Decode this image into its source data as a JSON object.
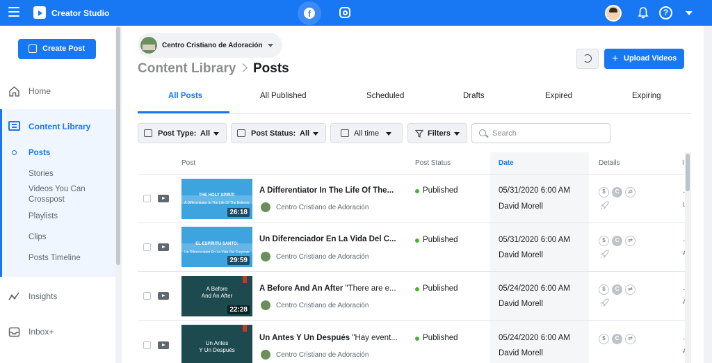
{
  "app": {
    "title": "Creator Studio",
    "brand_color": "#1877f2",
    "platform_tabs": [
      {
        "name": "facebook",
        "glyph": "f",
        "active": true
      },
      {
        "name": "instagram",
        "active": false
      }
    ],
    "help_glyph": "?"
  },
  "sidebar": {
    "create_post": "Create Post",
    "home": "Home",
    "content_library": "Content Library",
    "sub_items": [
      {
        "label": "Posts",
        "active": true
      },
      {
        "label": "Stories"
      },
      {
        "label": "Videos You Can Crosspost"
      },
      {
        "label": "Playlists"
      },
      {
        "label": "Clips"
      },
      {
        "label": "Posts Timeline"
      }
    ],
    "insights": "Insights",
    "inbox": "Inbox+"
  },
  "main": {
    "page_name": "Centro Cristiano de Adoración",
    "breadcrumb_parent": "Content Library",
    "breadcrumb_current": "Posts",
    "upload_label": "Upload Videos",
    "upload_plus": "+",
    "tabs": [
      {
        "label": "All Posts",
        "active": true
      },
      {
        "label": "All Published"
      },
      {
        "label": "Scheduled"
      },
      {
        "label": "Drafts"
      },
      {
        "label": "Expired"
      },
      {
        "label": "Expiring"
      }
    ],
    "filters": {
      "post_type_label": "Post Type:",
      "post_type_value": "All",
      "post_status_label": "Post Status:",
      "post_status_value": "All",
      "time_label": "All time",
      "filters_label": "Filters",
      "search_placeholder": "Search"
    },
    "columns": {
      "post": "Post",
      "status": "Post Status",
      "date": "Date",
      "details": "Details",
      "extra": "I"
    },
    "rows": [
      {
        "thumb_line1": "THE HOLY SPIRIT:",
        "thumb_line2": "A Differentiator In The Life Of The Believer",
        "duration": "26:18",
        "title_bold": "A Differentiator In The Life Of The...",
        "title_rest": "",
        "page": "Centro Cristiano de Adoración",
        "status": "Published",
        "date": "05/31/2020 6:00 AM",
        "author": "David Morell",
        "edge_top": "-",
        "edge_bottom": "L"
      },
      {
        "thumb_line1": "EL ESPÍRITU SANTO:",
        "thumb_line2": "Un Diferenciador En La Vida Del Creyente",
        "duration": "29:59",
        "title_bold": "Un Diferenciador En La Vida Del C...",
        "title_rest": "",
        "page": "Centro Cristiano de Adoración",
        "status": "Published",
        "date": "05/31/2020 6:00 AM",
        "author": "David Morell",
        "edge_top": "-",
        "edge_bottom": "A"
      },
      {
        "thumb_line1": "A Before",
        "thumb_line2": "And An After",
        "duration": "22:28",
        "title_bold": "A Before And An After",
        "title_rest": " \"There are e...",
        "page": "Centro Cristiano de Adoración",
        "status": "Published",
        "date": "05/24/2020 6:00 AM",
        "author": "David Morell",
        "edge_top": "-",
        "edge_bottom": "A"
      },
      {
        "thumb_line1": "Un Antes",
        "thumb_line2": "Y Un Después",
        "duration": "",
        "title_bold": "Un Antes Y Un Después",
        "title_rest": " \"Hay event...",
        "page": "Centro Cristiano de Adoración",
        "status": "Published",
        "date": "05/24/2020 6:00 AM",
        "author": "David Morell",
        "edge_top": "-",
        "edge_bottom": "A"
      }
    ],
    "detail_icons": [
      "monetization-icon",
      "copyright-icon",
      "crosspost-icon",
      "boost-icon"
    ],
    "detail_glyphs": {
      "money": "$",
      "copyright": "C",
      "crosspost": "⇄"
    },
    "status_color": "#42b72a"
  }
}
